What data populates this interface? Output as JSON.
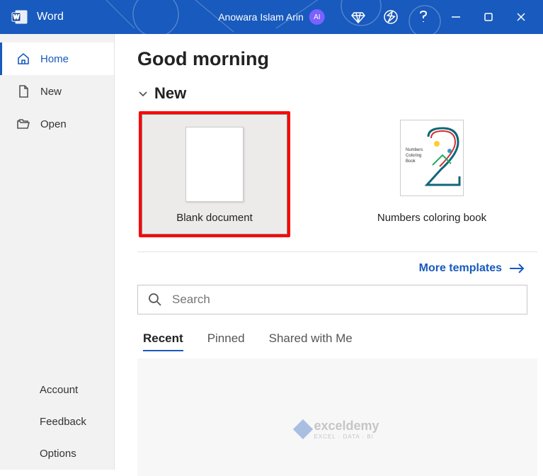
{
  "titlebar": {
    "app_name": "Word",
    "user_name": "Anowara Islam Arin",
    "avatar_initials": "AI"
  },
  "sidebar": {
    "nav": {
      "home": "Home",
      "new": "New",
      "open": "Open"
    },
    "footer": {
      "account": "Account",
      "feedback": "Feedback",
      "options": "Options"
    }
  },
  "main": {
    "greeting": "Good morning",
    "section_new": "New",
    "templates": {
      "blank": "Blank document",
      "numbers": "Numbers coloring book",
      "numbers_thumb_line1": "Numbers",
      "numbers_thumb_line2": "Coloring",
      "numbers_thumb_line3": "Book"
    },
    "more_templates": "More templates",
    "search_placeholder": "Search",
    "tabs": {
      "recent": "Recent",
      "pinned": "Pinned",
      "shared": "Shared with Me"
    },
    "watermark": "exceldemy",
    "watermark_sub": "EXCEL · DATA · BI"
  }
}
